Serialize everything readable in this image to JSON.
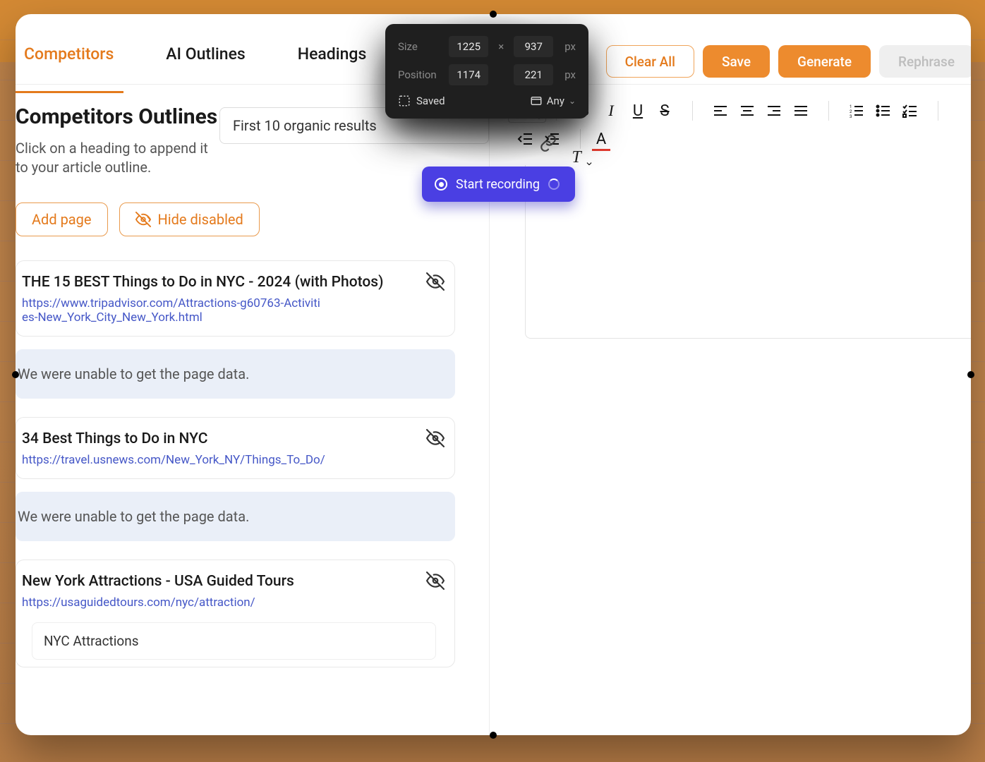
{
  "tabs": {
    "competitors": "Competitors",
    "ai_outlines": "AI Outlines",
    "headings": "Headings"
  },
  "actions": {
    "clear_all": "Clear All",
    "save": "Save",
    "generate": "Generate",
    "rephrase": "Rephrase"
  },
  "left": {
    "title": "Competitors Outlines",
    "subtitle": "Click on a heading to append it to your article outline.",
    "select_label": "First 10 organic results",
    "add_page": "Add page",
    "hide_disabled": "Hide disabled"
  },
  "results": [
    {
      "title": "THE 15 BEST Things to Do in NYC - 2024 (with Photos)",
      "url": "https://www.tripadvisor.com/Attractions-g60763-Activities-New_York_City_New_York.html",
      "warning": "We were unable to get the page data."
    },
    {
      "title": "34 Best Things to Do in NYC",
      "url": "https://travel.usnews.com/New_York_NY/Things_To_Do/",
      "warning": "We were unable to get the page data."
    },
    {
      "title": "New York Attractions - USA Guided Tours",
      "url": "https://usaguidedtours.com/nyc/attraction/",
      "sub_heading": "NYC Attractions"
    }
  ],
  "float": {
    "size_label": "Size",
    "size_w": "1225",
    "size_h": "937",
    "pos_label": "Position",
    "pos_x": "1174",
    "pos_y": "221",
    "unit": "px",
    "times": "×",
    "saved": "Saved",
    "any": "Any"
  },
  "record": {
    "label": "Start recording"
  }
}
